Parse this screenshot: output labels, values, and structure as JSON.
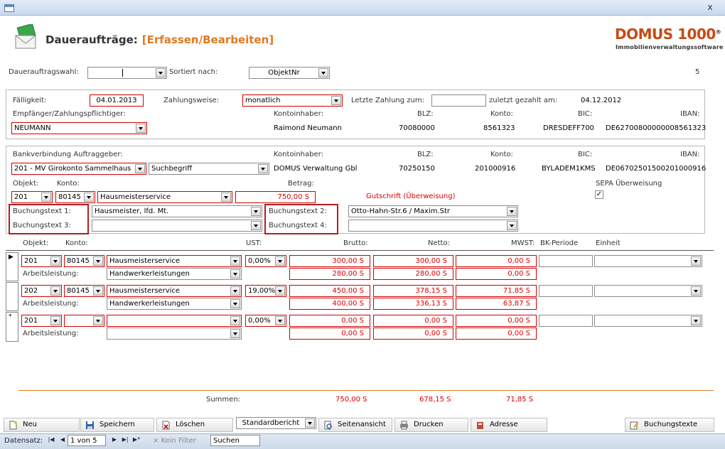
{
  "window": {
    "close_glyph": "x"
  },
  "header": {
    "title": "Daueraufträge:",
    "subtitle": "[Erfassen/Bearbeiten]",
    "brand": "DOMUS 1000",
    "brand_reg": "®",
    "brand_sub": "Immobilienverwaltungssoftware"
  },
  "top": {
    "wahl_label": "Dauerauftragswahl:",
    "wahl_value": "",
    "sort_label": "Sortiert nach:",
    "sort_value": "ObjektNr",
    "count": "5"
  },
  "p1": {
    "faellig_label": "Fälligkeit:",
    "faellig": "04.01.2013",
    "zw_label": "Zahlungsweise:",
    "zw": "monatlich",
    "letzte_label": "Letzte Zahlung zum:",
    "letzte": "",
    "zuletzt_label": "zuletzt gezahlt am:",
    "zuletzt": "04.12.2012",
    "empf_label": "Empfänger/Zahlungspflichtiger:",
    "empf": "NEUMANN",
    "ki_label": "Kontoinhaber:",
    "ki": "Raimond Neumann",
    "blz_label": "BLZ:",
    "blz": "70080000",
    "konto_label": "Konto:",
    "konto": "8561323",
    "bic_label": "BIC:",
    "bic": "DRESDEFF700",
    "iban_label": "IBAN:",
    "iban": "DE62700800000008561323"
  },
  "p2": {
    "bank_label": "Bankverbindung Auftraggeber:",
    "bank": "201 - MV Girokonto Sammelhaus",
    "such": "Suchbegriff",
    "ki_label": "Kontoinhaber:",
    "ki": "DOMUS Verwaltung Gbl",
    "blz_label": "BLZ:",
    "blz": "70250150",
    "konto_label": "Konto:",
    "konto": "201000916",
    "bic_label": "BIC:",
    "bic": "BYLADEM1KMS",
    "iban_label": "IBAN:",
    "iban": "DE06702501500201000916",
    "obj_label": "Objekt:",
    "obj": "201",
    "konto2_label": "Konto:",
    "konto2": "80145",
    "konto2_name": "Hausmeisterservice",
    "betrag_label": "Betrag:",
    "betrag": "750,00 S",
    "gutschrift": "Gutschrift (Überweisung)",
    "sepa_label": "SEPA Überweisung",
    "sepa_check": "✓",
    "bt1_label": "Buchungstext 1:",
    "bt1": "Hausmeister, lfd. Mt.",
    "bt2_label": "Buchungstext 2:",
    "bt2": "Otto-Hahn-Str.6 / Maxim.Str",
    "bt3_label": "Buchungstext 3:",
    "bt3": "",
    "bt4_label": "Buchungstext 4:",
    "bt4": ""
  },
  "grid": {
    "headers": {
      "objekt": "Objekt:",
      "konto": "Konto:",
      "ust": "UST:",
      "brutto": "Brutto:",
      "netto": "Netto:",
      "mwst": "MWST:",
      "bk": "BK-Periode",
      "einheit": "Einheit"
    },
    "arbeits_label": "Arbeitsleistung:",
    "rows": [
      {
        "marker": "▶",
        "obj": "201",
        "konto": "80145",
        "name": "Hausmeisterservice",
        "ust": "0,00%",
        "brutto": "300,00 S",
        "netto": "300,00 S",
        "mwst": "0,00 S",
        "art": "Handwerkerleistungen",
        "a_brutto": "280,00 S",
        "a_netto": "280,00 S",
        "a_mwst": "0,00 S"
      },
      {
        "marker": "",
        "obj": "202",
        "konto": "80145",
        "name": "Hausmeisterservice",
        "ust": "19,00%",
        "brutto": "450,00 S",
        "netto": "378,15 S",
        "mwst": "71,85 S",
        "art": "Handwerkerleistungen",
        "a_brutto": "400,00 S",
        "a_netto": "336,13 S",
        "a_mwst": "63,87 S"
      },
      {
        "marker": "*",
        "obj": "201",
        "konto": "",
        "name": "",
        "ust": "0,00%",
        "brutto": "0,00 S",
        "netto": "0,00 S",
        "mwst": "0,00 S",
        "art": "",
        "a_brutto": "0,00 S",
        "a_netto": "0,00 S",
        "a_mwst": "0,00 S"
      }
    ]
  },
  "sum": {
    "label": "Summen:",
    "brutto": "750,00 S",
    "netto": "678,15 S",
    "mwst": "71,85 S"
  },
  "toolbar": {
    "neu": "Neu",
    "speichern": "Speichern",
    "loeschen": "Löschen",
    "bericht": "Standardbericht",
    "seitenansicht": "Seitenansicht",
    "drucken": "Drucken",
    "adresse": "Adresse",
    "buchungstexte": "Buchungstexte"
  },
  "status": {
    "datensatz": "Datensatz:",
    "pos": "1 von 5",
    "filter": "Kein Filter",
    "suchen": "Suchen"
  }
}
